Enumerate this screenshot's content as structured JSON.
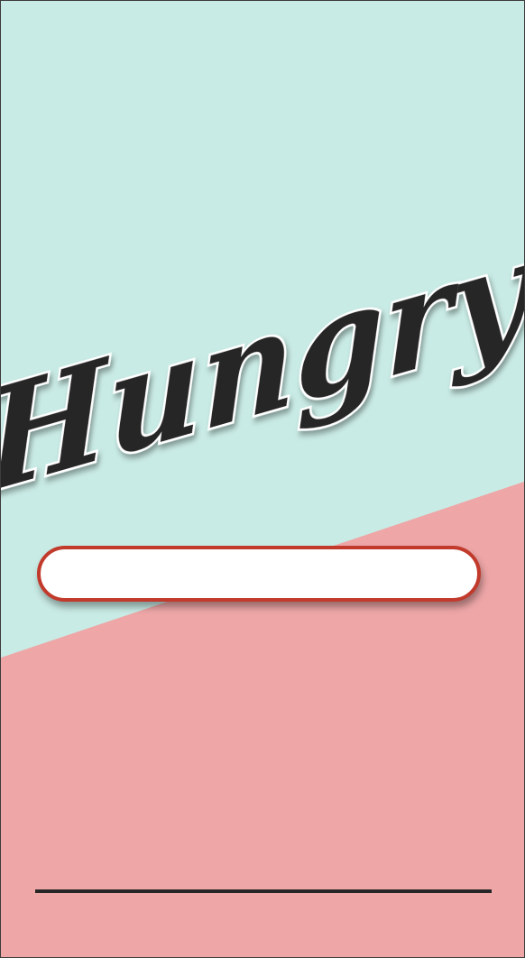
{
  "app": {
    "logo_text": "Hungry"
  },
  "colors": {
    "top_background": "#c9ebe5",
    "bottom_background": "#eea6a7",
    "logo_fill": "#252525",
    "logo_outline": "#ffffff",
    "field_border": "#c13a2c",
    "rule": "#262626"
  },
  "search": {
    "value": "",
    "placeholder": ""
  }
}
